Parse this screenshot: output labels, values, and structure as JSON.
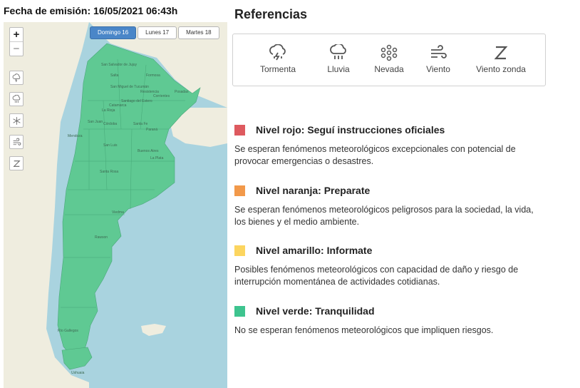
{
  "issue_date": "Fecha de emisión: 16/05/2021 06:43h",
  "map": {
    "zoom_in": "+",
    "zoom_out": "−",
    "tabs": [
      {
        "label": "Domingo 16",
        "active": true
      },
      {
        "label": "Lunes 17",
        "active": false
      },
      {
        "label": "Martes 18",
        "active": false
      }
    ],
    "layer_buttons": [
      "storm-icon",
      "rain-icon",
      "snow-icon",
      "wind-icon",
      "zonda-wind-icon"
    ],
    "region_color": "#5fc993",
    "land_color": "#efeddf",
    "water_color": "#a9d3df",
    "labels": [
      "San Salvador de Jujuy",
      "Salta",
      "Formosa",
      "San Miguel de Tucumán",
      "Resistencia",
      "Corrientes",
      "Posadas",
      "Santiago del Estero",
      "Catamarca",
      "La Rioja",
      "San Juan",
      "Córdoba",
      "Santa Fe",
      "Paraná",
      "Mendoza",
      "San Luis",
      "Buenos Aires",
      "La Plata",
      "Santa Rosa",
      "Viedma",
      "Rawson",
      "Río Gallegos",
      "Ushuaia"
    ]
  },
  "references": {
    "title": "Referencias",
    "items": [
      {
        "label": "Tormenta",
        "icon": "storm-icon"
      },
      {
        "label": "Lluvia",
        "icon": "rain-icon"
      },
      {
        "label": "Nevada",
        "icon": "snow-icon"
      },
      {
        "label": "Viento",
        "icon": "wind-icon"
      },
      {
        "label": "Viento zonda",
        "icon": "zonda-wind-icon"
      }
    ]
  },
  "levels": [
    {
      "name": "Nivel rojo: Seguí instrucciones oficiales",
      "color": "#de5a5f",
      "description": "Se esperan fenómenos meteorológicos excepcionales con potencial de provocar emergencias o desastres."
    },
    {
      "name": "Nivel naranja: Preparate",
      "color": "#f2994a",
      "description": "Se esperan fenómenos meteorológicos peligrosos para la sociedad, la vida, los bienes y el medio ambiente."
    },
    {
      "name": "Nivel amarillo: Informate",
      "color": "#fcd55f",
      "description": "Posibles fenómenos meteorológicos con capacidad de daño y riesgo de interrupción momentánea de actividades cotidianas."
    },
    {
      "name": "Nivel verde: Tranquilidad",
      "color": "#3ec48f",
      "description": "No se esperan fenómenos meteorológicos que impliquen riesgos."
    }
  ]
}
